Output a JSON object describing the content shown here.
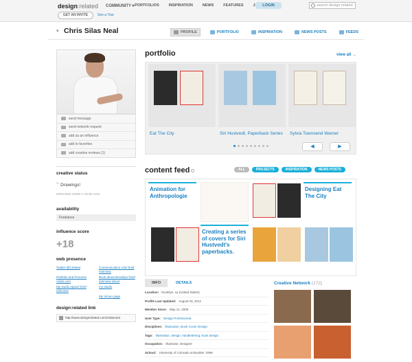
{
  "brand": {
    "logo_bold": "design",
    "logo_thin": ":related"
  },
  "topbar": {
    "community": "COMMUNITY",
    "invite": "GET AN INVITE",
    "tour": "See a Tour",
    "nav": [
      "PORTFOLIOS",
      "INSPIRATION",
      "NEWS",
      "FEATURES",
      "JOBS"
    ],
    "login": "LOGIN",
    "search_placeholder": "search design:related"
  },
  "profile": {
    "name": "Chris Silas Neal",
    "tabs": [
      {
        "label": "PROFILE",
        "active": true
      },
      {
        "label": "PORTFOLIO",
        "active": false
      },
      {
        "label": "INSPIRATION",
        "active": false
      },
      {
        "label": "NEWS POSTS",
        "active": false
      },
      {
        "label": "FEEDS",
        "active": false
      }
    ]
  },
  "sidebar": {
    "actions": [
      "send message",
      "send network request",
      "add as an influence",
      "add to favorites",
      "add creative reviews (1)"
    ],
    "creative_status_title": "creative status",
    "status": "Drawings!",
    "status_updated": "UPDATED OVER 1 YEAR AGO",
    "availability_title": "availability",
    "availability": "Freelance",
    "influence_title": "influence score",
    "influence_score": "+18",
    "web_presence_title": "web presence",
    "web_presence": [
      "Twitter-@CSNeal",
      "Communication Arts/ brief interview",
      "Portfolio and Process/ csilas.com",
      "Book about Brooklyn/ brief interview about",
      "My studio space/ brief interview",
      "my studio",
      "",
      "My Vimeo page"
    ],
    "link_title": "design:related link",
    "link_url": "http://www.designrelated.com/csilasneal"
  },
  "portfolio": {
    "title": "portfolio",
    "view_all": "view all →",
    "items": [
      "Eat The City",
      "Siri Hustvedt, Paperback Series",
      "Sylvia Townsend Warner"
    ]
  },
  "feed": {
    "title": "content feed",
    "filters": [
      {
        "label": "ALL",
        "active": true
      },
      {
        "label": "PROJECTS",
        "active": false
      },
      {
        "label": "INSPIRATION",
        "active": false
      },
      {
        "label": "NEWS POSTS",
        "active": false
      }
    ],
    "posts": [
      "Animation for Anthropologie",
      "Designing Eat The City",
      "Creating a series of covers for Siri Hustvedt's paperbacks."
    ]
  },
  "info": {
    "tabs": [
      {
        "label": "INFO",
        "active": true
      },
      {
        "label": "DETAILS",
        "active": false
      }
    ],
    "rows": [
      {
        "k": "Location:",
        "v": "brooklyn, ny (United States)"
      },
      {
        "k": "Profile Last Updated:",
        "v": "August 03, 2012"
      },
      {
        "k": "Member Since:",
        "v": "May 12, 2008"
      },
      {
        "k": "User Type:",
        "v": "Design Professional",
        "link": true
      },
      {
        "k": "Disciplines:",
        "v": "Illustration, Book Cover Design",
        "link": true
      },
      {
        "k": "Tags:",
        "v": "illustration, design, handlettering, book design",
        "link": true
      },
      {
        "k": "Occupation:",
        "v": "Illustrator, Designer"
      },
      {
        "k": "School:",
        "v": "University of Colorado at Boulder '1999"
      }
    ]
  },
  "network": {
    "title": "Creative Network",
    "count": "(172)"
  },
  "colors": {
    "accent": "#1a7fc1",
    "cyan": "#1ab0d8"
  }
}
